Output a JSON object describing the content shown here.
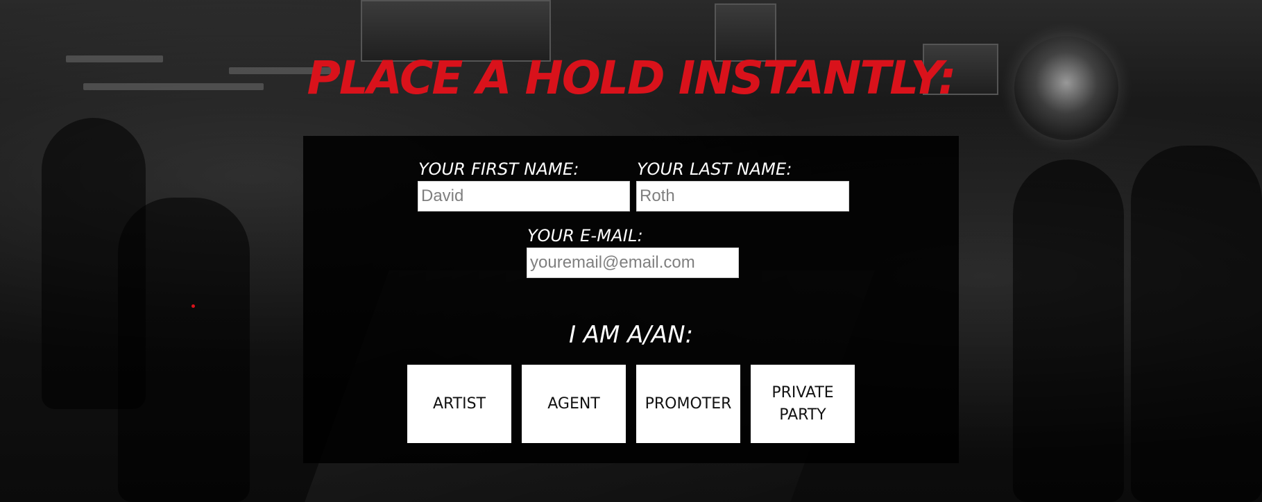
{
  "headline": "PLACE A HOLD INSTANTLY:",
  "form": {
    "first_name": {
      "label": "YOUR FIRST NAME:",
      "placeholder": "David"
    },
    "last_name": {
      "label": "YOUR LAST NAME:",
      "placeholder": "Roth"
    },
    "email": {
      "label": "YOUR E-MAIL:",
      "placeholder": "youremail@email.com"
    },
    "role_title": "I AM A/AN:",
    "roles": [
      {
        "label": "ARTIST"
      },
      {
        "label": "AGENT"
      },
      {
        "label": "PROMOTER"
      },
      {
        "label": "PRIVATE PARTY"
      }
    ]
  },
  "colors": {
    "accent": "#d9121b",
    "panel": "#000000",
    "button_bg": "#ffffff"
  }
}
